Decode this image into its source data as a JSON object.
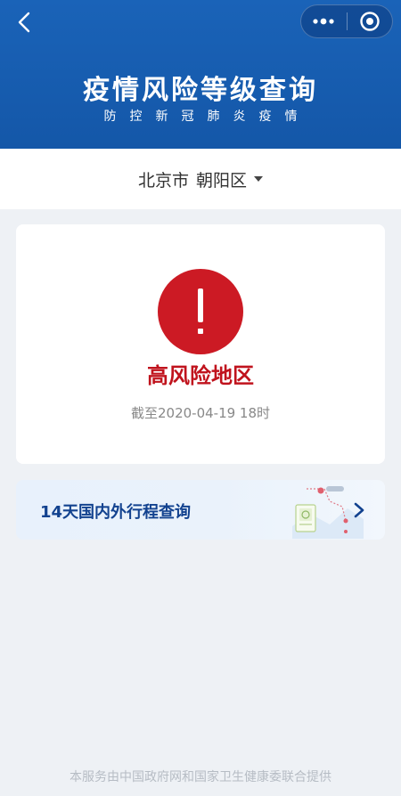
{
  "header": {
    "title": "疫情风险等级查询",
    "subtitle": "防控新冠肺炎疫情",
    "icons": {
      "back": "chevron-left-icon",
      "more": "more-dots-icon",
      "close": "target-circle-icon"
    }
  },
  "location": {
    "city": "北京市",
    "district": "朝阳区"
  },
  "risk": {
    "level": "高风险地区",
    "timestamp": "截至2020-04-19 18时",
    "icon": "exclamation-icon"
  },
  "trip": {
    "label": "14天国内外行程查询",
    "icon": "chevron-right-icon"
  },
  "footer": {
    "text": "本服务由中国政府网和国家卫生健康委联合提供"
  },
  "colors": {
    "header_bg": "#1a63b8",
    "risk_red": "#cc1a24",
    "trip_text": "#12428f",
    "page_bg": "#eef1f5"
  }
}
